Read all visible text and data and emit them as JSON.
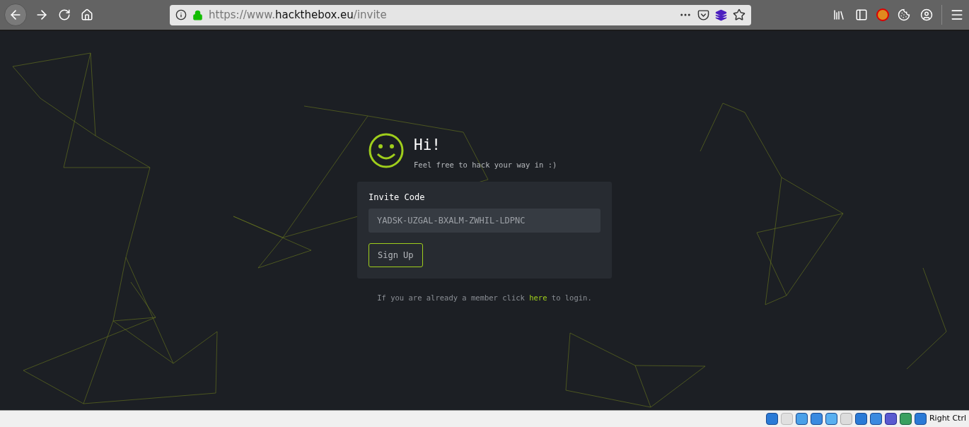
{
  "browser": {
    "url_prefix": "https://www.",
    "url_domain": "hackthebox.eu",
    "url_path": "/invite"
  },
  "hero": {
    "title": "Hi!",
    "subtitle": "Feel free to hack your way in :)"
  },
  "form": {
    "label": "Invite Code",
    "value": "YADSK-UZGAL-BXALM-ZWHIL-LDPNC",
    "button": "Sign Up"
  },
  "footer": {
    "before": "If you are already a member click",
    "link": "here",
    "after": "to login."
  },
  "status_bar": {
    "host_key": "Right Ctrl"
  }
}
